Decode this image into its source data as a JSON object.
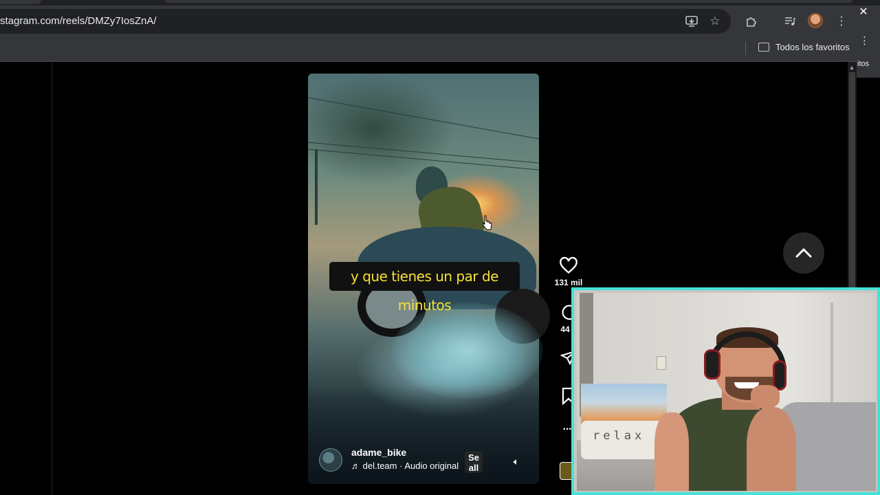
{
  "browser": {
    "url": "stagram.com/reels/DMZy7IosZnA/",
    "bookmarks_label": "Todos los favoritos",
    "side_panel_text": "itos",
    "icons": [
      "install-icon",
      "star-icon",
      "extensions-icon",
      "media-icon",
      "profile-avatar",
      "menu-icon",
      "close-icon"
    ]
  },
  "reel": {
    "subtitle": "y que tienes un par de minutos",
    "username": "adame_bike",
    "audio": "del.team · Audio original",
    "follow_label": "Se\nall",
    "likes": "131 mil",
    "comments": "44"
  },
  "colors": {
    "subtitle_text": "#f7e332",
    "webcam_border": "#44e3d6",
    "chrome_bg": "#35363a"
  },
  "webcam": {
    "pillow_text": "relax"
  }
}
